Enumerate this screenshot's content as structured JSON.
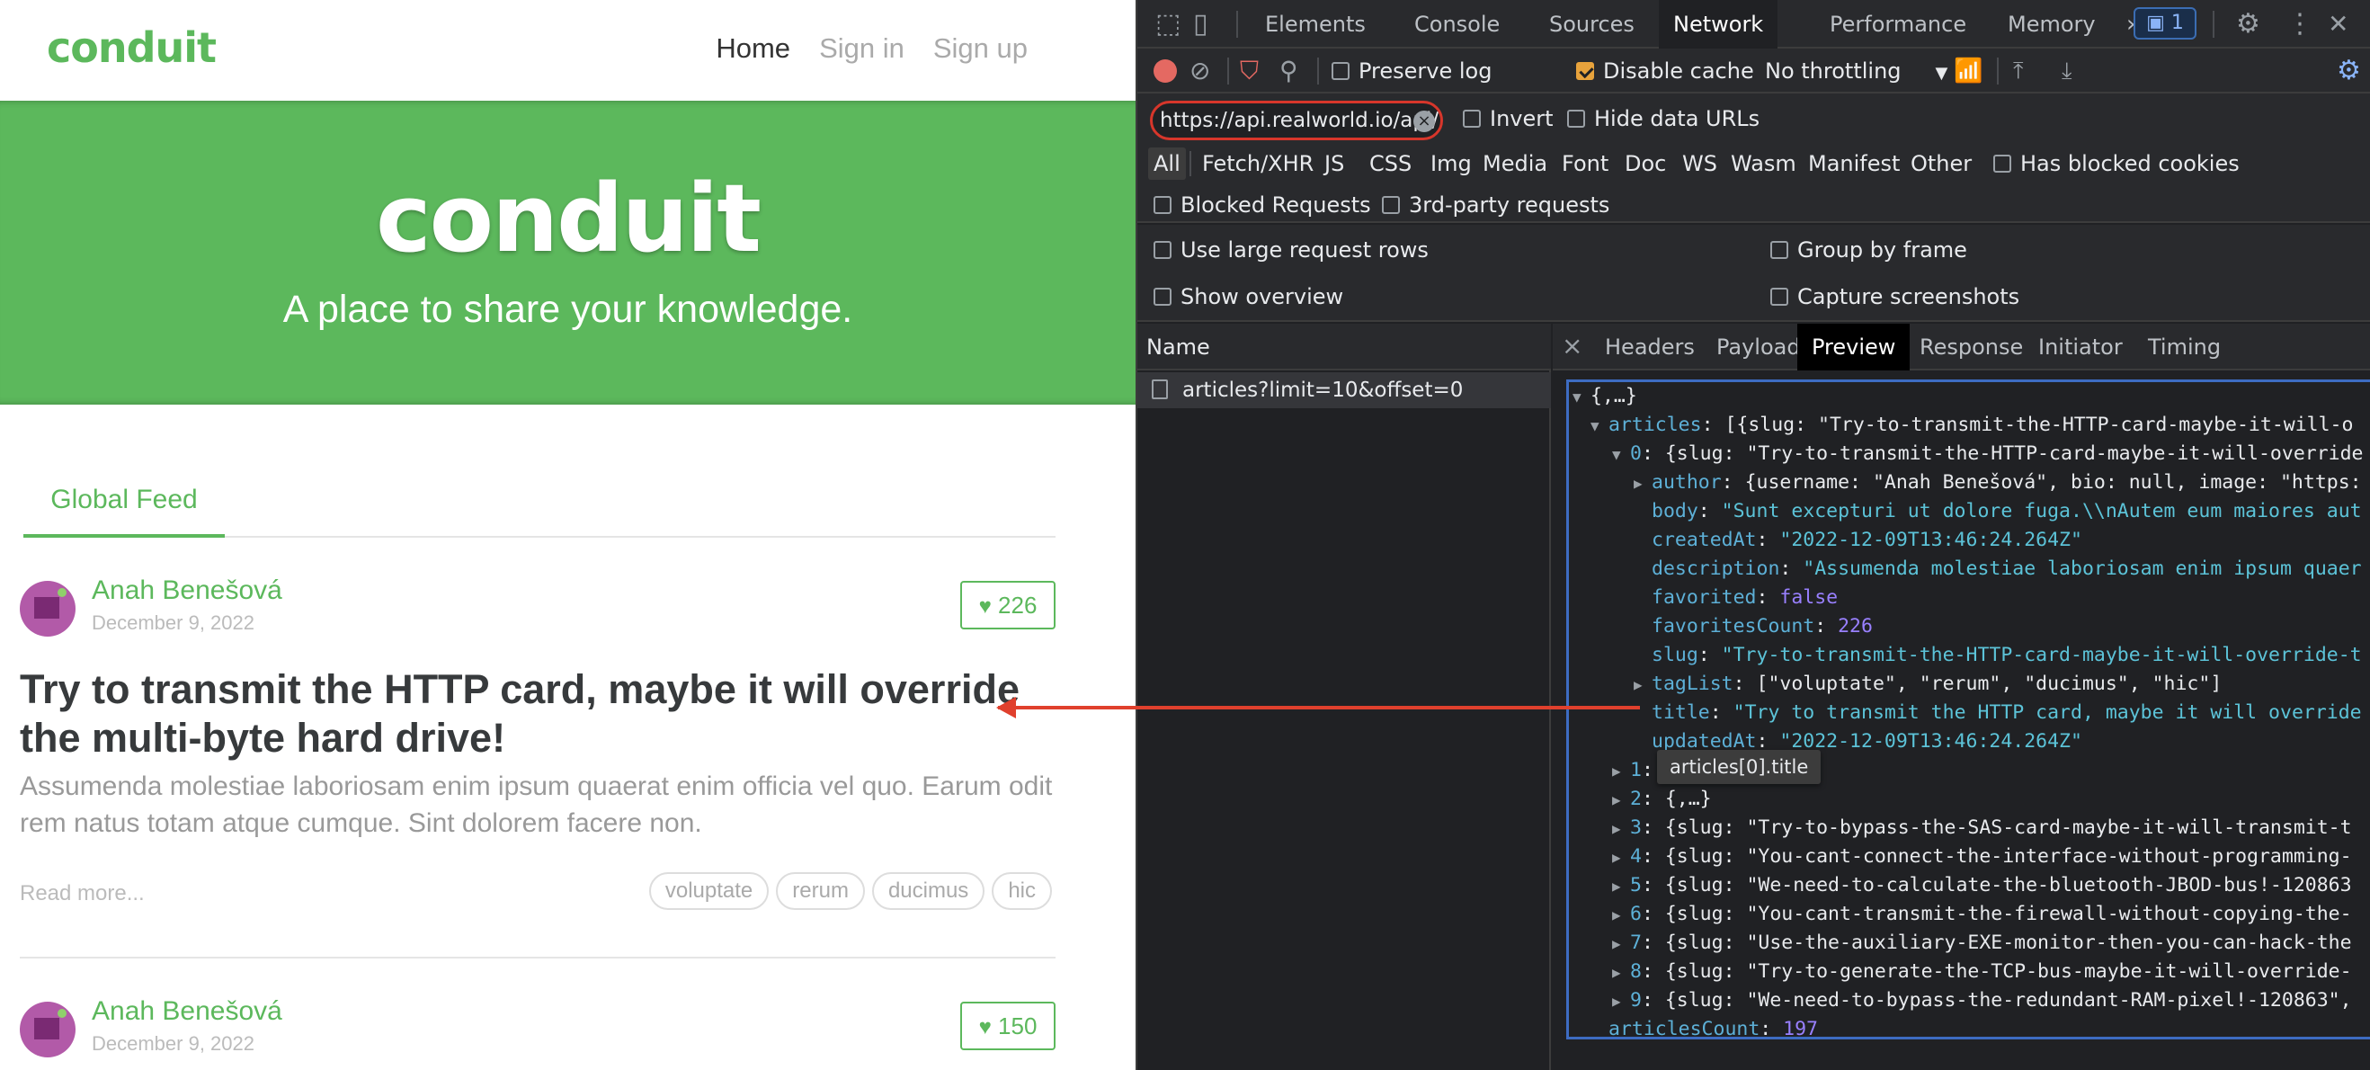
{
  "app": {
    "brand": "conduit",
    "nav": [
      "Home",
      "Sign in",
      "Sign up"
    ],
    "banner_title": "conduit",
    "banner_tagline": "A place to share your knowledge.",
    "feed_tab": "Global Feed",
    "articles": [
      {
        "author": "Anah Benešová",
        "date": "December 9, 2022",
        "favorites": "226",
        "title": "Try to transmit the HTTP card, maybe it will override the multi-byte hard drive!",
        "description": "Assumenda molestiae laboriosam enim ipsum quaerat enim officia vel quo. Earum odit rem natus totam atque cumque. Sint dolorem facere non.",
        "read_more": "Read more...",
        "tags": [
          "voluptate",
          "rerum",
          "ducimus",
          "hic"
        ]
      },
      {
        "author": "Anah Benešová",
        "date": "December 9, 2022",
        "favorites": "150"
      }
    ],
    "accent_color": "#5cb85c"
  },
  "devtools": {
    "tabs": [
      "Elements",
      "Console",
      "Sources",
      "Network",
      "Performance",
      "Memory"
    ],
    "more_tabs": "»",
    "issues_count": "1",
    "toolbar": {
      "preserve_log": "Preserve log",
      "disable_cache": "Disable cache",
      "throttling": "No throttling"
    },
    "filter": {
      "value": "https://api.realworld.io/api/",
      "invert": "Invert",
      "hide_data_urls": "Hide data URLs"
    },
    "type_filters": [
      "All",
      "Fetch/XHR",
      "JS",
      "CSS",
      "Img",
      "Media",
      "Font",
      "Doc",
      "WS",
      "Wasm",
      "Manifest",
      "Other"
    ],
    "has_blocked_cookies": "Has blocked cookies",
    "blocked_requests": "Blocked Requests",
    "third_party": "3rd-party requests",
    "options": {
      "large_rows": "Use large request rows",
      "group_by_frame": "Group by frame",
      "show_overview": "Show overview",
      "capture_screenshots": "Capture screenshots"
    },
    "name_header": "Name",
    "request": "articles?limit=10&offset=0",
    "detail_tabs": [
      "Headers",
      "Payload",
      "Preview",
      "Response",
      "Initiator",
      "Timing"
    ],
    "tooltip": "articles[0].title",
    "preview": {
      "root": "{,…}",
      "articles_key": "articles",
      "articles_summary": "[{slug: \"Try-to-transmit-the-HTTP-card-maybe-it-will-o",
      "item0": "{slug: \"Try-to-transmit-the-HTTP-card-maybe-it-will-override",
      "author": "{username: \"Anah Benešová\", bio: null, image: \"https:",
      "body": "\"Sunt excepturi ut dolore fuga.\\\\nAutem eum maiores aut",
      "createdAt": "\"2022-12-09T13:46:24.264Z\"",
      "description": "\"Assumenda molestiae laboriosam enim ipsum quaer",
      "favorited": "false",
      "favoritesCount": "226",
      "slug": "\"Try-to-transmit-the-HTTP-card-maybe-it-will-override-t",
      "tagList": "[\"voluptate\", \"rerum\", \"ducimus\", \"hic\"]",
      "title": "\"Try to transmit the HTTP card, maybe it will override",
      "updatedAt": "\"2022-12-09T13:46:24.264Z\"",
      "item1": "",
      "item2": "{,…}",
      "item3": "{slug: \"Try-to-bypass-the-SAS-card-maybe-it-will-transmit-t",
      "item4": "{slug: \"You-cant-connect-the-interface-without-programming-",
      "item5": "{slug: \"We-need-to-calculate-the-bluetooth-JBOD-bus!-120863",
      "item6": "{slug: \"You-cant-transmit-the-firewall-without-copying-the-",
      "item7": "{slug: \"Use-the-auxiliary-EXE-monitor-then-you-can-hack-the",
      "item8": "{slug: \"Try-to-generate-the-TCP-bus-maybe-it-will-override-",
      "item9": "{slug: \"We-need-to-bypass-the-redundant-RAM-pixel!-120863\",",
      "articlesCount": "197"
    }
  }
}
